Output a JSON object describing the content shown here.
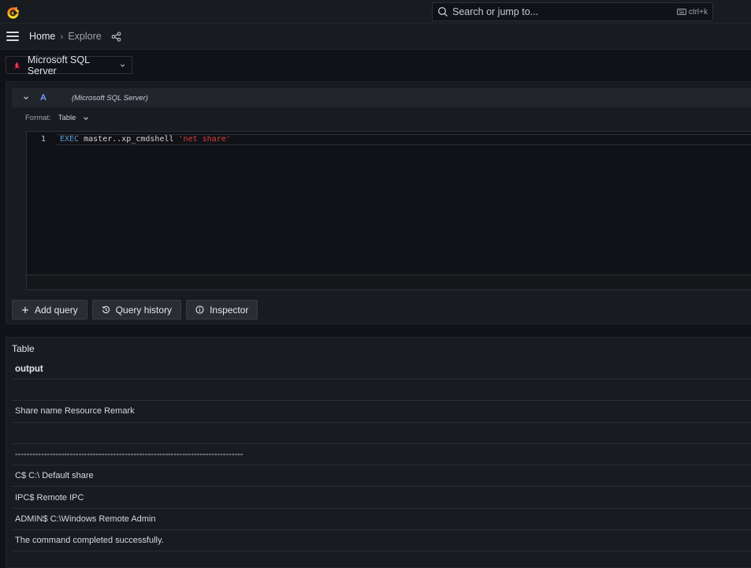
{
  "search": {
    "placeholder": "Search or jump to...",
    "shortcut": "ctrl+k"
  },
  "breadcrumb": {
    "home": "Home",
    "separator": "›",
    "current": "Explore"
  },
  "datasource": {
    "name": "Microsoft SQL Server"
  },
  "query": {
    "ref_id": "A",
    "datasource_label": "(Microsoft SQL Server)",
    "format_label": "Format:",
    "format_value": "Table",
    "line_number": "1",
    "code_keyword": "EXEC",
    "code_identifier": " master..xp_cmdshell ",
    "code_string": "'net share'"
  },
  "buttons": {
    "add_query": "Add query",
    "query_history": "Query history",
    "inspector": "Inspector"
  },
  "results": {
    "title": "Table",
    "column": "output",
    "rows": [
      "",
      "Share name Resource Remark",
      "",
      "-------------------------------------------------------------------------------",
      "C$ C:\\ Default share",
      "IPC$ Remote IPC",
      "ADMIN$ C:\\Windows Remote Admin",
      "The command completed successfully."
    ]
  },
  "colors": {
    "background": "#111217",
    "panel": "#181b1f",
    "accent_blue": "#6e9fff",
    "keyword": "#569cd6",
    "string": "#e03c3c",
    "logo_orange": "#f46800"
  }
}
